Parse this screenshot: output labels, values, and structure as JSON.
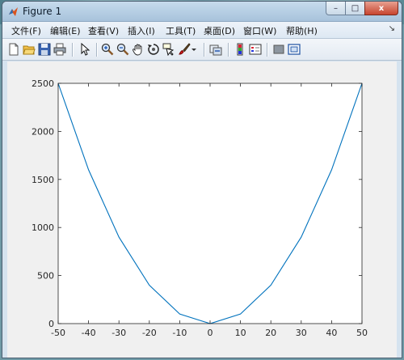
{
  "window": {
    "title": "Figure 1",
    "controls": {
      "minimize": "–",
      "maximize": "□",
      "close": "x"
    }
  },
  "menubar": {
    "items": [
      {
        "label": "文件(F)"
      },
      {
        "label": "编辑(E)"
      },
      {
        "label": "查看(V)"
      },
      {
        "label": "插入(I)"
      },
      {
        "label": "工具(T)"
      },
      {
        "label": "桌面(D)"
      },
      {
        "label": "窗口(W)"
      },
      {
        "label": "帮助(H)"
      }
    ],
    "overflow": "↘"
  },
  "toolbar": {
    "buttons": [
      {
        "icon": "new-figure-icon"
      },
      {
        "icon": "open-file-icon"
      },
      {
        "icon": "save-icon"
      },
      {
        "icon": "print-icon"
      },
      {
        "icon": "edit-plot-arrow-icon"
      },
      {
        "icon": "zoom-in-icon"
      },
      {
        "icon": "zoom-out-icon"
      },
      {
        "icon": "pan-hand-icon"
      },
      {
        "icon": "rotate-3d-icon"
      },
      {
        "icon": "data-cursor-icon"
      },
      {
        "icon": "brush-icon"
      },
      {
        "icon": "link-plot-icon"
      },
      {
        "icon": "colorbar-icon"
      },
      {
        "icon": "legend-icon"
      },
      {
        "icon": "hide-plot-tools-icon"
      },
      {
        "icon": "show-plot-tools-icon"
      }
    ]
  },
  "colors": {
    "line": "#0072bd",
    "axes_bg": "#ffffff",
    "figure_bg": "#f0f0f0"
  },
  "chart_data": {
    "type": "line",
    "title": "",
    "xlabel": "",
    "ylabel": "",
    "xlim": [
      -50,
      50
    ],
    "ylim": [
      0,
      2500
    ],
    "grid": false,
    "xticks": [
      -50,
      -40,
      -30,
      -20,
      -10,
      0,
      10,
      20,
      30,
      40,
      50
    ],
    "yticks": [
      0,
      500,
      1000,
      1500,
      2000,
      2500
    ],
    "series": [
      {
        "x": [
          -50,
          -40,
          -30,
          -20,
          -10,
          0,
          10,
          20,
          30,
          40,
          50
        ],
        "y": [
          2500,
          1600,
          900,
          400,
          100,
          0,
          100,
          400,
          900,
          1600,
          2500
        ]
      }
    ]
  }
}
